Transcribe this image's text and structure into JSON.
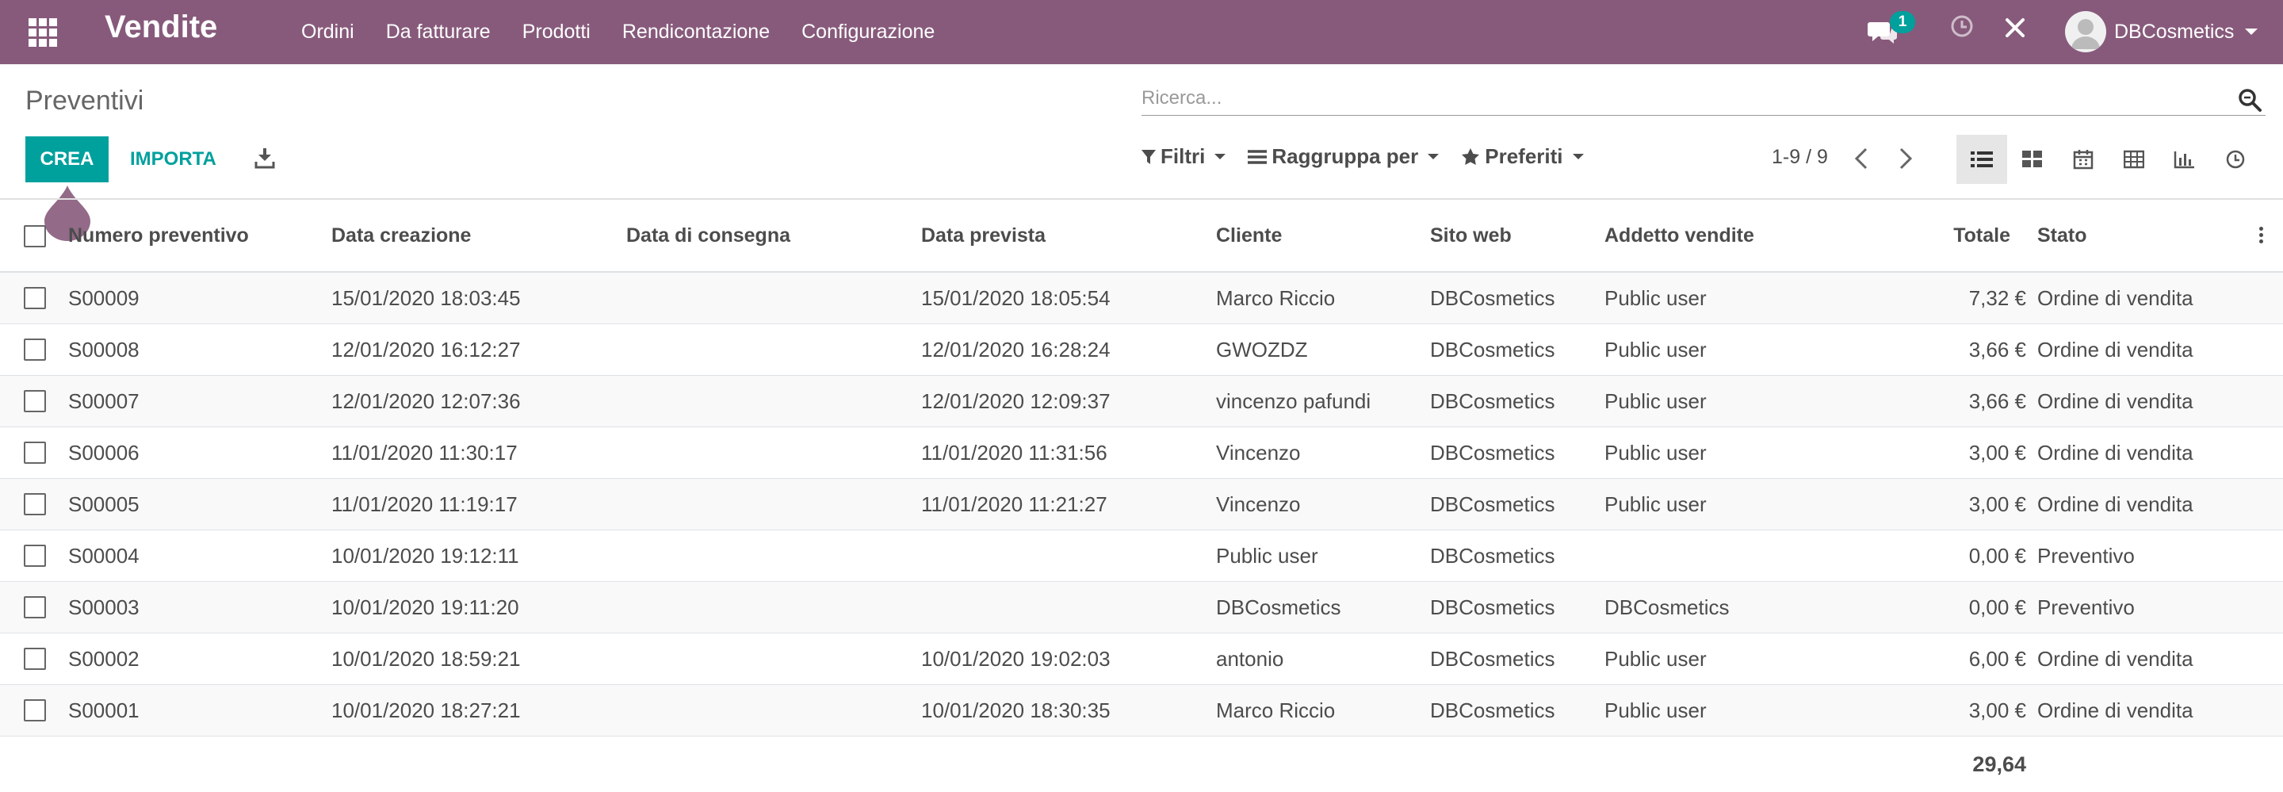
{
  "app": {
    "title": "Vendite",
    "menu": [
      "Ordini",
      "Da fatturare",
      "Prodotti",
      "Rendicontazione",
      "Configurazione"
    ],
    "chat_count": "1",
    "user_name": "DBCosmetics",
    "brand_color": "#875a7b",
    "accent_color": "#00a09d"
  },
  "control_panel": {
    "breadcrumb": "Preventivi",
    "search_placeholder": "Ricerca...",
    "create_label": "CREA",
    "import_label": "IMPORTA",
    "filters_label": "Filtri",
    "groupby_label": "Raggruppa per",
    "favorites_label": "Preferiti",
    "pager": "1-9 / 9",
    "views": [
      "list-view-icon",
      "kanban-view-icon",
      "calendar-view-icon",
      "pivot-view-icon",
      "graph-view-icon",
      "activity-view-icon"
    ],
    "active_view": "list"
  },
  "table": {
    "columns": [
      "Numero preventivo",
      "Data creazione",
      "Data di consegna",
      "Data prevista",
      "Cliente",
      "Sito web",
      "Addetto vendite",
      "Totale",
      "Stato"
    ],
    "rows": [
      [
        "S00009",
        "15/01/2020 18:03:45",
        "",
        "15/01/2020 18:05:54",
        "Marco Riccio",
        "DBCosmetics",
        "Public user",
        "7,32 €",
        "Ordine di vendita"
      ],
      [
        "S00008",
        "12/01/2020 16:12:27",
        "",
        "12/01/2020 16:28:24",
        "GWOZDZ",
        "DBCosmetics",
        "Public user",
        "3,66 €",
        "Ordine di vendita"
      ],
      [
        "S00007",
        "12/01/2020 12:07:36",
        "",
        "12/01/2020 12:09:37",
        "vincenzo pafundi",
        "DBCosmetics",
        "Public user",
        "3,66 €",
        "Ordine di vendita"
      ],
      [
        "S00006",
        "11/01/2020 11:30:17",
        "",
        "11/01/2020 11:31:56",
        "Vincenzo",
        "DBCosmetics",
        "Public user",
        "3,00 €",
        "Ordine di vendita"
      ],
      [
        "S00005",
        "11/01/2020 11:19:17",
        "",
        "11/01/2020 11:21:27",
        "Vincenzo",
        "DBCosmetics",
        "Public user",
        "3,00 €",
        "Ordine di vendita"
      ],
      [
        "S00004",
        "10/01/2020 19:12:11",
        "",
        "",
        "Public user",
        "DBCosmetics",
        "",
        "0,00 €",
        "Preventivo"
      ],
      [
        "S00003",
        "10/01/2020 19:11:20",
        "",
        "",
        "DBCosmetics",
        "DBCosmetics",
        "DBCosmetics",
        "0,00 €",
        "Preventivo"
      ],
      [
        "S00002",
        "10/01/2020 18:59:21",
        "",
        "10/01/2020 19:02:03",
        "antonio",
        "DBCosmetics",
        "Public user",
        "6,00 €",
        "Ordine di vendita"
      ],
      [
        "S00001",
        "10/01/2020 18:27:21",
        "",
        "10/01/2020 18:30:35",
        "Marco Riccio",
        "DBCosmetics",
        "Public user",
        "3,00 €",
        "Ordine di vendita"
      ]
    ],
    "total": "29,64"
  }
}
